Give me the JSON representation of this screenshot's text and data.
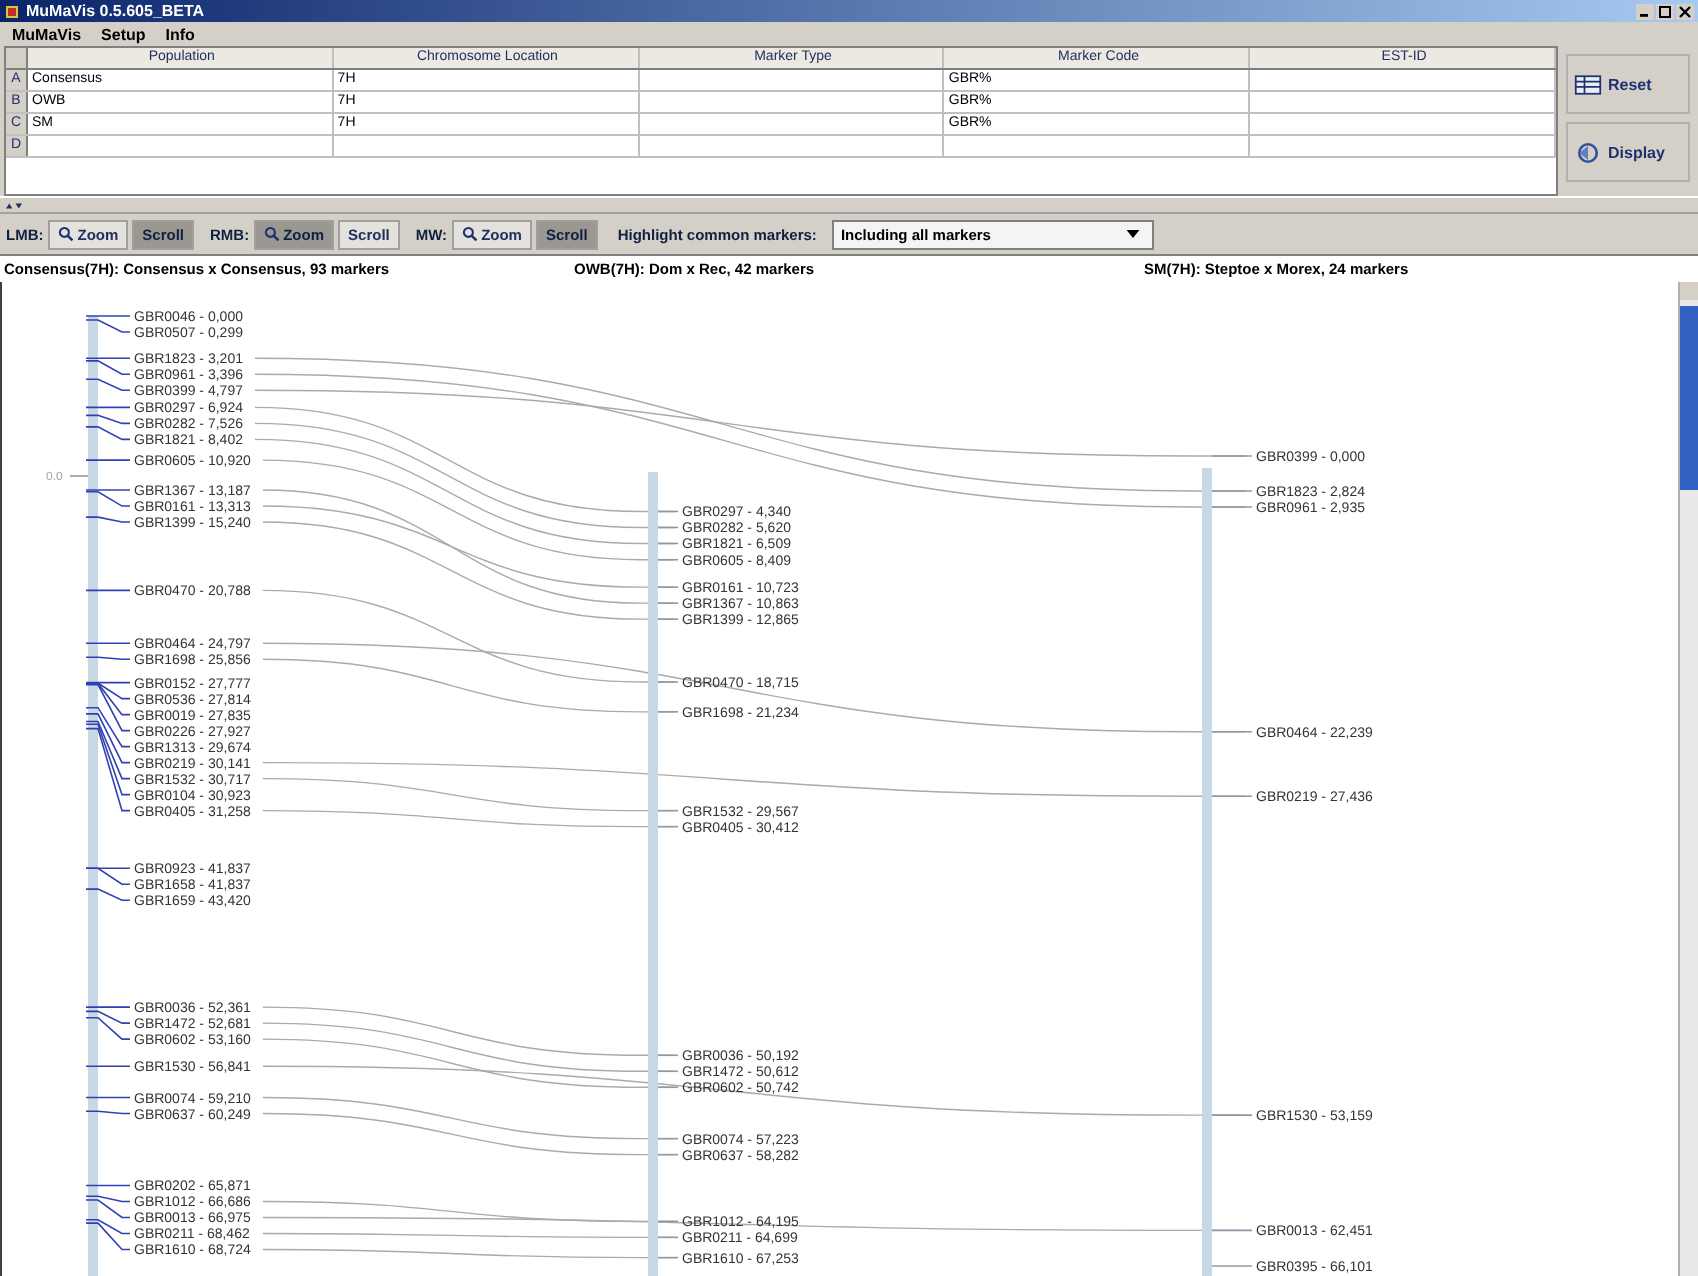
{
  "window": {
    "title": "MuMaVis 0.5.605_BETA"
  },
  "menu": [
    "MuMaVis",
    "Setup",
    "Info"
  ],
  "table": {
    "columns": [
      "Population",
      "Chromosome Location",
      "Marker Type",
      "Marker Code",
      "EST-ID"
    ],
    "rows": [
      {
        "key": "A",
        "cells": [
          "Consensus",
          "7H",
          null,
          "GBR%"
        ]
      },
      {
        "key": "B",
        "cells": [
          "OWB",
          "7H",
          null,
          "GBR%"
        ]
      },
      {
        "key": "C",
        "cells": [
          "SM",
          "7H",
          null,
          "GBR%"
        ]
      },
      {
        "key": "D"
      }
    ]
  },
  "side_buttons": [
    {
      "label": "Reset",
      "kind": "reset"
    },
    {
      "label": "Display",
      "kind": "display"
    }
  ],
  "toolbar": {
    "groups": [
      {
        "label": "LMB:",
        "options": [
          {
            "label": "Zoom",
            "selected": false
          },
          {
            "label": "Scroll",
            "selected": true
          }
        ]
      },
      {
        "label": "RMB:",
        "options": [
          {
            "label": "Zoom",
            "selected": true
          },
          {
            "label": "Scroll",
            "selected": false
          }
        ]
      },
      {
        "label": "MW:",
        "options": [
          {
            "label": "Zoom",
            "selected": false
          },
          {
            "label": "Scroll",
            "selected": true
          }
        ]
      }
    ],
    "highlight_label": "Highlight common markers:",
    "highlight_value": "Including all markers"
  },
  "maps": [
    {
      "title": "Consensus(7H): Consensus x Consensus, 93 markers",
      "axis_label": "0.0",
      "markers": [
        "GBR0046 - 0,000",
        "GBR0507 - 0,299",
        "GBR1823 - 3,201",
        "GBR0961 - 3,396",
        "GBR0399 - 4,797",
        "GBR0297 - 6,924",
        "GBR0282 - 7,526",
        "GBR1821 - 8,402",
        "GBR0605 - 10,920",
        "GBR1367 - 13,187",
        "GBR0161 - 13,313",
        "GBR1399 - 15,240",
        "GBR0470 - 20,788",
        "GBR0464 - 24,797",
        "GBR1698 - 25,856",
        "GBR0152 - 27,777",
        "GBR0536 - 27,814",
        "GBR0019 - 27,835",
        "GBR0226 - 27,927",
        "GBR1313 - 29,674",
        "GBR0219 - 30,141",
        "GBR1532 - 30,717",
        "GBR0104 - 30,923",
        "GBR0405 - 31,258",
        "GBR0923 - 41,837",
        "GBR1658 - 41,837",
        "GBR1659 - 43,420",
        "GBR0036 - 52,361",
        "GBR1472 - 52,681",
        "GBR0602 - 53,160",
        "GBR1530 - 56,841",
        "GBR0074 - 59,210",
        "GBR0637 - 60,249",
        "GBR0202 - 65,871",
        "GBR1012 - 66,686",
        "GBR0013 - 66,975",
        "GBR0211 - 68,462",
        "GBR1610 - 68,724"
      ]
    },
    {
      "title": "OWB(7H): Dom x Rec, 42 markers",
      "markers": [
        "GBR0297 - 4,340",
        "GBR0282 - 5,620",
        "GBR1821 - 6,509",
        "GBR0605 - 8,409",
        "GBR0161 - 10,723",
        "GBR1367 - 10,863",
        "GBR1399 - 12,865",
        "GBR0470 - 18,715",
        "GBR1698 - 21,234",
        "GBR1532 - 29,567",
        "GBR0405 - 30,412",
        "GBR0036 - 50,192",
        "GBR1472 - 50,612",
        "GBR0602 - 50,742",
        "GBR0074 - 57,223",
        "GBR0637 - 58,282",
        "GBR1012 - 64,195",
        "GBR0211 - 64,699",
        "GBR1610 - 67,253"
      ]
    },
    {
      "title": "SM(7H): Steptoe x Morex, 24 markers",
      "markers": [
        "GBR0399 - 0,000",
        "GBR1823 - 2,824",
        "GBR0961 - 2,935",
        "GBR0464 - 22,239",
        "GBR0219 - 27,436",
        "GBR1530 - 53,159",
        "GBR0013 - 62,451",
        "GBR0395 - 66,101"
      ]
    }
  ]
}
